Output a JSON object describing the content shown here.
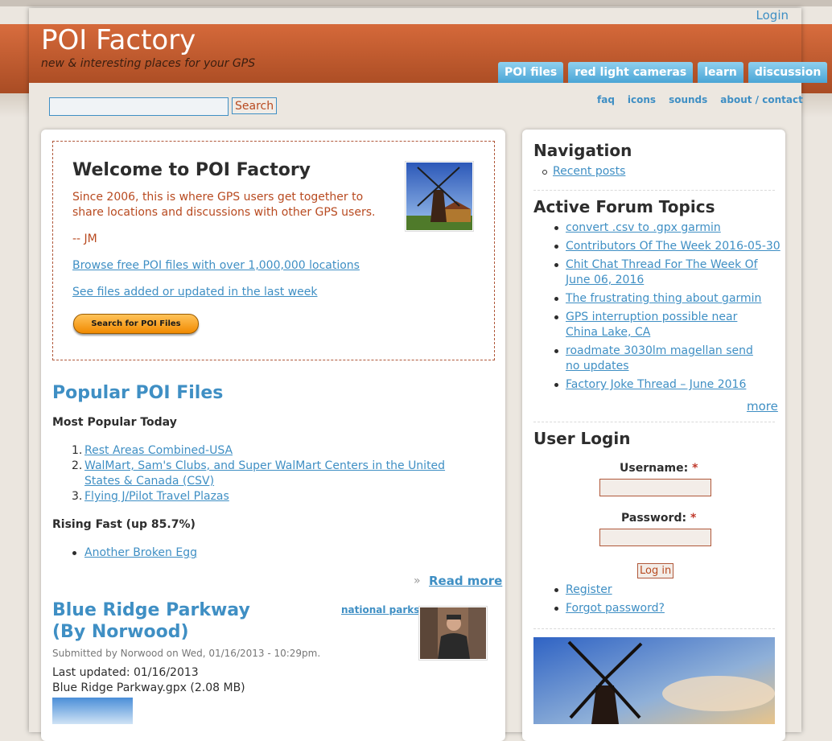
{
  "header": {
    "login": "Login",
    "site_name": "POI Factory",
    "slogan": "new & interesting places for your GPS",
    "tabs": [
      "POI files",
      "red light cameras",
      "learn",
      "discussion"
    ],
    "secondary_links": [
      "faq",
      "icons",
      "sounds",
      "about / contact"
    ]
  },
  "search": {
    "value": "",
    "button": "Search"
  },
  "welcome": {
    "title": "Welcome to POI Factory",
    "intro": "Since 2006, this is where GPS users get together to share locations and discussions with other GPS users.",
    "signature": "-- JM",
    "link_browse": "Browse free POI files with over 1,000,000 locations",
    "link_recent": "See files added or updated in the last week",
    "search_button": "Search for POI Files"
  },
  "popular": {
    "title": "Popular POI Files",
    "today_label": "Most Popular Today",
    "today_items": [
      "Rest Areas Combined-USA",
      "WalMart, Sam's Clubs, and Super WalMart Centers in the United States & Canada (CSV)",
      "Flying J/Pilot Travel Plazas"
    ],
    "rising_label": "Rising Fast (up 85.7%)",
    "rising_items": [
      "Another Broken Egg"
    ],
    "read_more": "Read more"
  },
  "node": {
    "title": "Blue Ridge Parkway (By Norwood)",
    "tag": "national parks",
    "submitted": "Submitted by Norwood on Wed, 01/16/2013 - 10:29pm.",
    "last_updated": "Last updated: 01/16/2013",
    "file": "Blue Ridge Parkway.gpx (2.08 MB)"
  },
  "sidebar": {
    "nav_title": "Navigation",
    "nav_items": [
      "Recent posts"
    ],
    "forum_title": "Active Forum Topics",
    "forum_items": [
      "convert .csv to .gpx garmin",
      "Contributors Of The Week 2016-05-30",
      "Chit Chat Thread For The Week Of June 06, 2016",
      "The frustrating thing about garmin",
      "GPS interruption possible near China Lake, CA",
      "roadmate 3030lm magellan send no updates",
      "Factory Joke Thread – June 2016"
    ],
    "more": "more",
    "login_title": "User Login",
    "username_label": "Username:",
    "password_label": "Password:",
    "required_mark": "*",
    "login_button": "Log in",
    "register": "Register",
    "forgot": "Forgot password?"
  }
}
